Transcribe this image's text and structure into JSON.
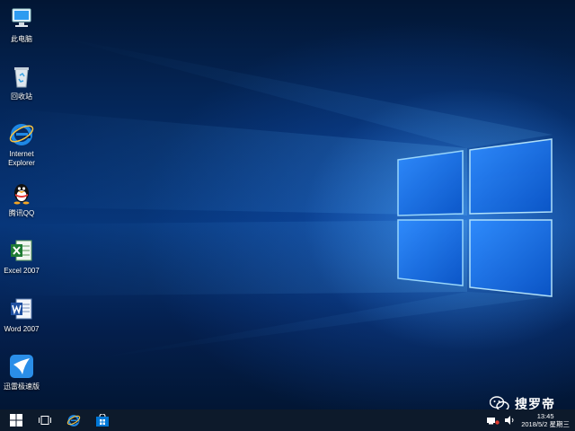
{
  "desktop_icons": [
    {
      "label": "此电脑",
      "icon": "computer-icon"
    },
    {
      "label": "回收站",
      "icon": "recycle-bin-icon"
    },
    {
      "label": "Internet\nExplorer",
      "icon": "internet-explorer-icon"
    },
    {
      "label": "腾讯QQ",
      "icon": "qq-penguin-icon"
    },
    {
      "label": "Excel 2007",
      "icon": "excel-icon"
    },
    {
      "label": "Word 2007",
      "icon": "word-icon"
    },
    {
      "label": "迅雷极速版",
      "icon": "xunlei-icon"
    }
  ],
  "taskbar": {
    "start_icon": "windows-start-icon",
    "task_view_icon": "task-view-icon",
    "pinned": [
      "internet-explorer-icon",
      "store-icon"
    ],
    "background": "#0d1a2b"
  },
  "tray": {
    "time": "13:45",
    "date": "2018/5/2 星期三"
  },
  "watermark": {
    "text": "搜罗帝",
    "icon": "wechat-icon"
  },
  "colors": {
    "accent": "#1a8cff",
    "desktop_dark": "#021634"
  }
}
